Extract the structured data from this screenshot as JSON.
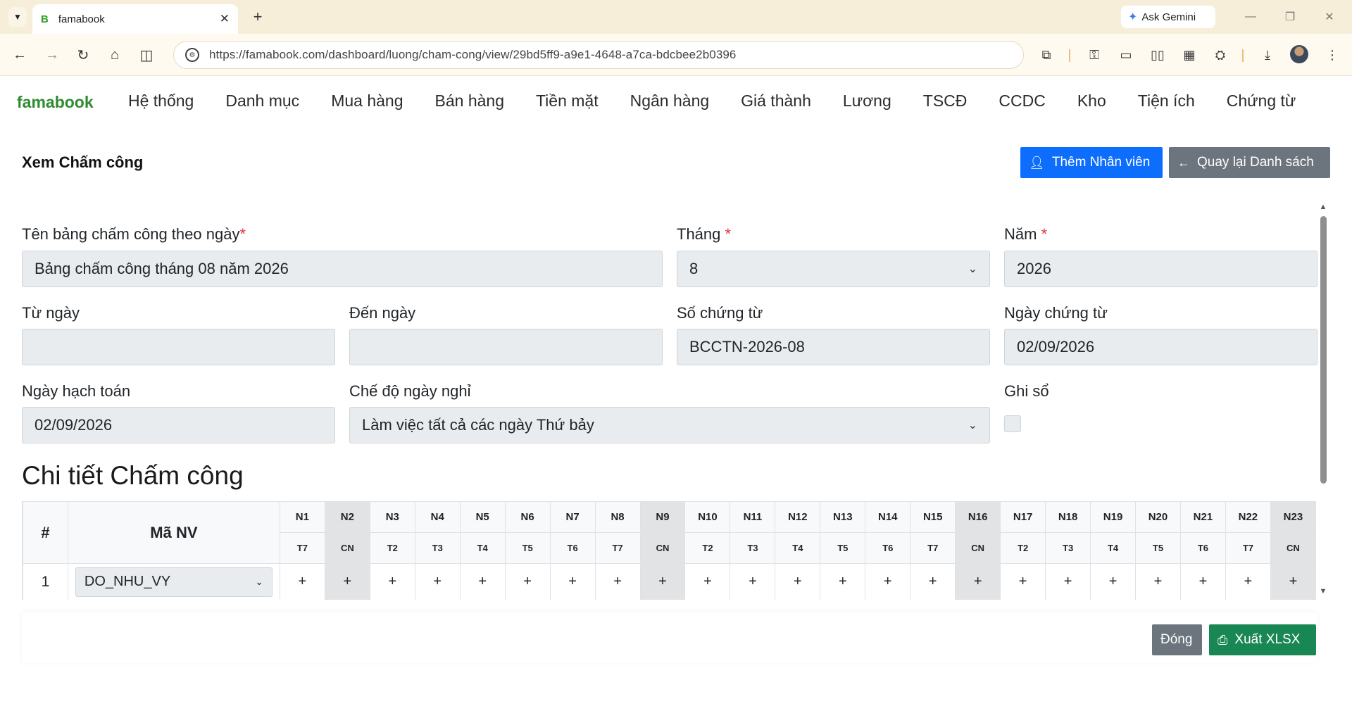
{
  "browser": {
    "tab_title": "famabook",
    "tab_favicon": "B",
    "url": "https://famabook.com/dashboard/luong/cham-cong/view/29bd5ff9-a9e1-4648-a7ca-bdcbee2b0396",
    "gemini_label": "Ask Gemini"
  },
  "nav": {
    "brand": "famabook",
    "items": [
      "Hệ thống",
      "Danh mục",
      "Mua hàng",
      "Bán hàng",
      "Tiền mặt",
      "Ngân hàng",
      "Giá thành",
      "Lương",
      "TSCĐ",
      "CCDC",
      "Kho",
      "Tiện ích",
      "Chứng từ"
    ]
  },
  "page": {
    "title": "Xem Chấm công",
    "add_employee_label": "Thêm Nhân viên",
    "back_label": "Quay lại Danh sách"
  },
  "form": {
    "name_label": "Tên bảng chấm công theo ngày",
    "name_value": "Bảng chấm công tháng 08 năm 2026",
    "month_label": "Tháng",
    "month_value": "8",
    "year_label": "Năm",
    "year_value": "2026",
    "from_label": "Từ ngày",
    "from_value": "",
    "to_label": "Đến ngày",
    "to_value": "",
    "doc_no_label": "Số chứng từ",
    "doc_no_value": "BCCTN-2026-08",
    "doc_date_label": "Ngày chứng từ",
    "doc_date_value": "02/09/2026",
    "posting_date_label": "Ngày hạch toán",
    "posting_date_value": "02/09/2026",
    "holiday_mode_label": "Chế độ ngày nghỉ",
    "holiday_mode_value": "Làm việc tất cả các ngày Thứ bảy",
    "posted_label": "Ghi sổ",
    "required_mark": "*"
  },
  "detail": {
    "title": "Chi tiết Chấm công",
    "col_hash": "#",
    "col_employee": "Mã NV",
    "days": [
      {
        "d": "N1",
        "w": "T7"
      },
      {
        "d": "N2",
        "w": "CN"
      },
      {
        "d": "N3",
        "w": "T2"
      },
      {
        "d": "N4",
        "w": "T3"
      },
      {
        "d": "N5",
        "w": "T4"
      },
      {
        "d": "N6",
        "w": "T5"
      },
      {
        "d": "N7",
        "w": "T6"
      },
      {
        "d": "N8",
        "w": "T7"
      },
      {
        "d": "N9",
        "w": "CN"
      },
      {
        "d": "N10",
        "w": "T2"
      },
      {
        "d": "N11",
        "w": "T3"
      },
      {
        "d": "N12",
        "w": "T4"
      },
      {
        "d": "N13",
        "w": "T5"
      },
      {
        "d": "N14",
        "w": "T6"
      },
      {
        "d": "N15",
        "w": "T7"
      },
      {
        "d": "N16",
        "w": "CN"
      },
      {
        "d": "N17",
        "w": "T2"
      },
      {
        "d": "N18",
        "w": "T3"
      },
      {
        "d": "N19",
        "w": "T4"
      },
      {
        "d": "N20",
        "w": "T5"
      },
      {
        "d": "N21",
        "w": "T6"
      },
      {
        "d": "N22",
        "w": "T7"
      },
      {
        "d": "N23",
        "w": "CN"
      }
    ],
    "rows": [
      {
        "index": "1",
        "employee": "DO_NHU_VY",
        "cell": "+"
      }
    ]
  },
  "footer": {
    "close_label": "Đóng",
    "export_label": "Xuất XLSX"
  }
}
